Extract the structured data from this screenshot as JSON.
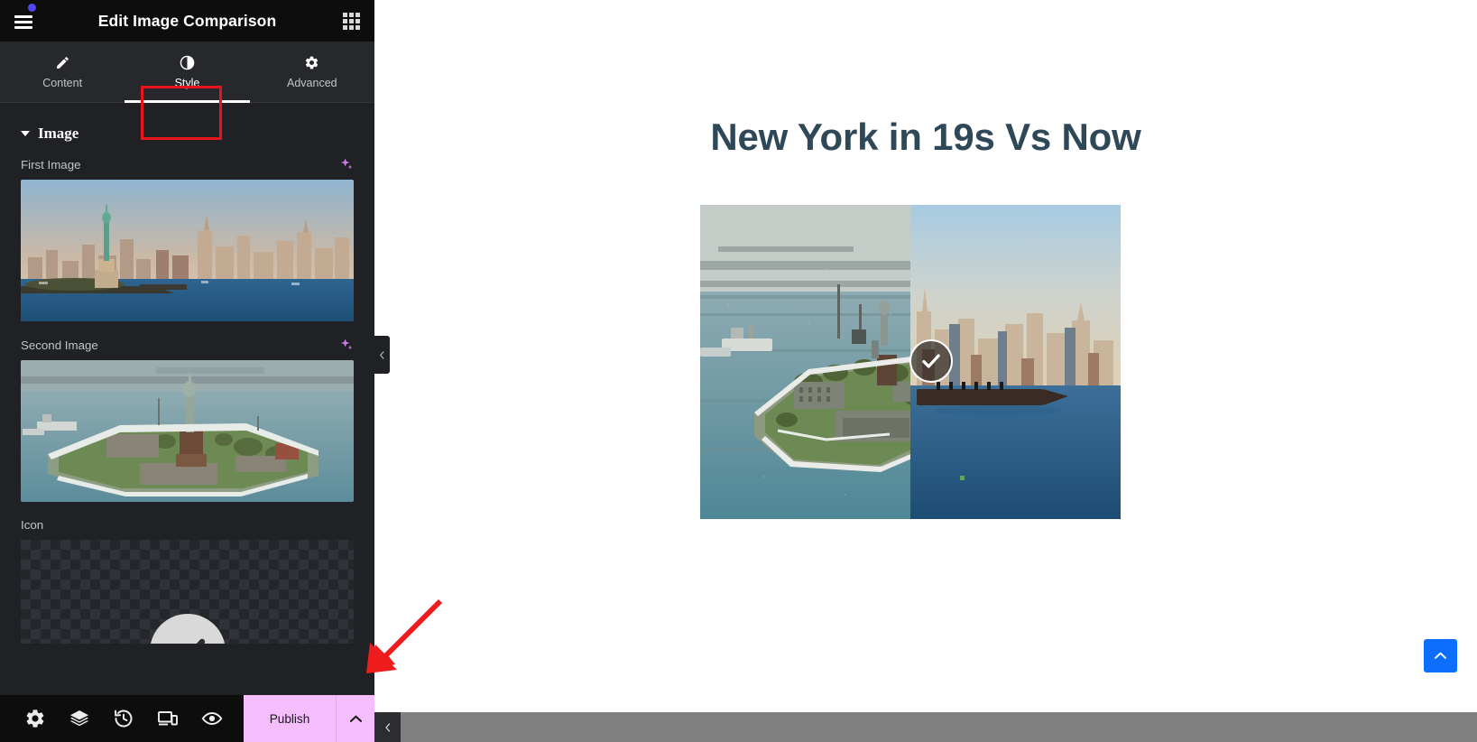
{
  "panel": {
    "title": "Edit Image Comparison",
    "menu_icon": "hamburger-icon",
    "apps_icon": "apps-grid-icon",
    "tabs": [
      {
        "label": "Content",
        "icon": "pencil-icon",
        "active": false
      },
      {
        "label": "Style",
        "icon": "contrast-half-circle-icon",
        "active": true
      },
      {
        "label": "Advanced",
        "icon": "gear-icon",
        "active": false
      }
    ],
    "section": {
      "title": "Image",
      "expanded": true
    },
    "controls": [
      {
        "label": "First Image",
        "ai_icon": "ai-sparkle-icon",
        "preview": "statue-of-liberty-modern-skyline"
      },
      {
        "label": "Second Image",
        "ai_icon": "ai-sparkle-icon",
        "preview": "liberty-island-vintage-aerial"
      },
      {
        "label": "Icon",
        "preview": "checkmark-circle-on-transparency"
      }
    ],
    "footer": {
      "tools": [
        {
          "name": "settings-icon",
          "title": "Settings"
        },
        {
          "name": "layers-icon",
          "title": "Navigator"
        },
        {
          "name": "history-icon",
          "title": "History"
        },
        {
          "name": "responsive-icon",
          "title": "Responsive Mode"
        },
        {
          "name": "eye-icon",
          "title": "Preview Changes"
        }
      ],
      "publish_label": "Publish",
      "publish_caret_icon": "chevron-up-icon"
    },
    "collapse_handle_icon": "chevron-left-icon"
  },
  "canvas": {
    "heading": "New York in 19s Vs Now",
    "heading_color": "#2f4858",
    "comparison": {
      "left_image": "liberty-island-vintage-aerial",
      "right_image": "new-york-modern-skyline",
      "handle_icon": "checkmark-circle-handle",
      "divider_position_percent": 50
    },
    "scroll_top_icon": "chevron-up-icon",
    "scroll_top_color": "#0d6efd",
    "scrollbar": {
      "prev_icon": "chevron-left-icon"
    }
  },
  "annotations": {
    "style_tab_highlight_color": "#e8141c",
    "arrow_color": "#ee1c1c"
  }
}
